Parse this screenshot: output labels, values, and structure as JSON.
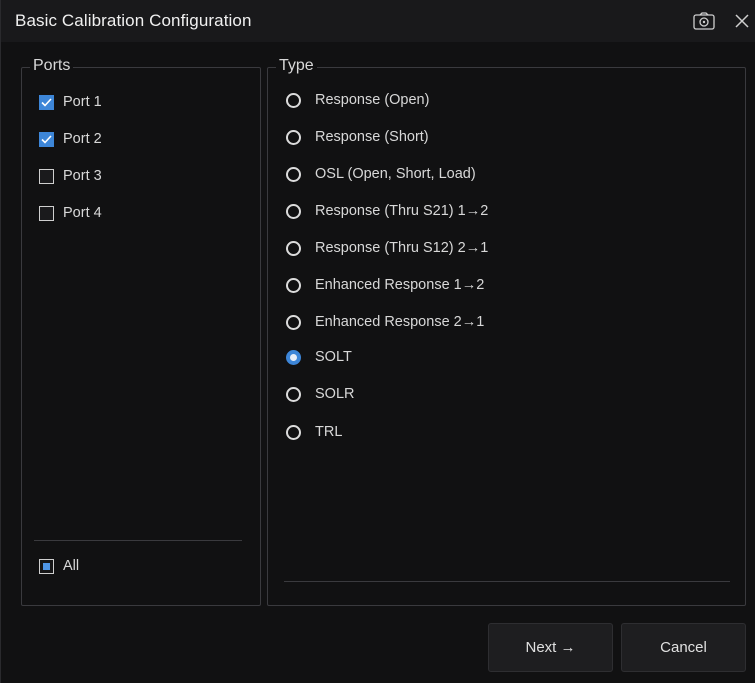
{
  "dialog": {
    "title": "Basic Calibration Configuration"
  },
  "icons": {
    "screenshot": "camera-icon",
    "close": "close-icon"
  },
  "ports": {
    "label": "Ports",
    "items": [
      {
        "label": "Port 1",
        "checked": true
      },
      {
        "label": "Port 2",
        "checked": true
      },
      {
        "label": "Port 3",
        "checked": false
      },
      {
        "label": "Port 4",
        "checked": false
      }
    ],
    "all_label": "All",
    "all_state": "partial"
  },
  "type": {
    "label": "Type",
    "options": [
      {
        "label": "Response (Open)",
        "selected": false
      },
      {
        "label": "Response (Short)",
        "selected": false
      },
      {
        "label": "OSL (Open, Short, Load)",
        "selected": false
      },
      {
        "label": "Response (Thru S21) 1→2",
        "selected": false
      },
      {
        "label": "Response (Thru S12) 2→1",
        "selected": false
      },
      {
        "label": "Enhanced Response 1→2",
        "selected": false
      },
      {
        "label": "Enhanced Response 2→1",
        "selected": false
      },
      {
        "label": "SOLT",
        "selected": true
      },
      {
        "label": "SOLR",
        "selected": false
      },
      {
        "label": "TRL",
        "selected": false
      }
    ]
  },
  "buttons": {
    "next": "Next →",
    "cancel": "Cancel"
  },
  "colors": {
    "accent": "#3d86d8",
    "background": "#111112",
    "border": "#3a3a3e",
    "text": "#d8d8d8"
  }
}
